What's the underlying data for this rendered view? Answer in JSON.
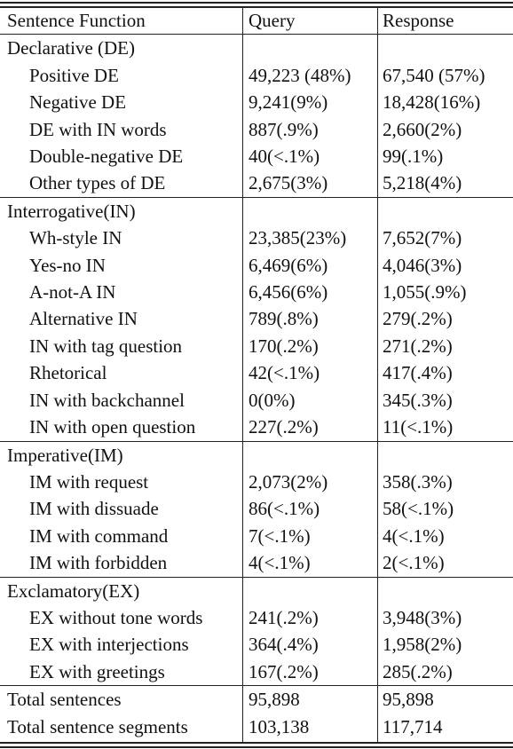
{
  "table": {
    "headers": [
      "Sentence Function",
      "Query",
      "Response"
    ],
    "groups": [
      {
        "label": "Declarative (DE)",
        "rows": [
          {
            "name": "Positive DE",
            "query": "49,223 (48%)",
            "response": "67,540 (57%)"
          },
          {
            "name": "Negative DE",
            "query": "9,241(9%)",
            "response": "18,428(16%)"
          },
          {
            "name": "DE with IN words",
            "query": "887(.9%)",
            "response": "2,660(2%)"
          },
          {
            "name": "Double-negative DE",
            "query": "40(<.1%)",
            "response": "99(.1%)"
          },
          {
            "name": "Other types of DE",
            "query": "2,675(3%)",
            "response": "5,218(4%)"
          }
        ]
      },
      {
        "label": "Interrogative(IN)",
        "rows": [
          {
            "name": "Wh-style IN",
            "query": "23,385(23%)",
            "response": "7,652(7%)"
          },
          {
            "name": "Yes-no IN",
            "query": "6,469(6%)",
            "response": "4,046(3%)"
          },
          {
            "name": "A-not-A IN",
            "query": "6,456(6%)",
            "response": "1,055(.9%)"
          },
          {
            "name": "Alternative IN",
            "query": "789(.8%)",
            "response": "279(.2%)"
          },
          {
            "name": "IN with tag question",
            "query": "170(.2%)",
            "response": "271(.2%)"
          },
          {
            "name": "Rhetorical",
            "query": "42(<.1%)",
            "response": "417(.4%)"
          },
          {
            "name": "IN with backchannel",
            "query": "0(0%)",
            "response": "345(.3%)"
          },
          {
            "name": "IN with open question",
            "query": "227(.2%)",
            "response": "11(<.1%)"
          }
        ]
      },
      {
        "label": "Imperative(IM)",
        "rows": [
          {
            "name": "IM with request",
            "query": "2,073(2%)",
            "response": "358(.3%)"
          },
          {
            "name": "IM with dissuade",
            "query": "86(<.1%)",
            "response": "58(<.1%)"
          },
          {
            "name": "IM with command",
            "query": "7(<.1%)",
            "response": "4(<.1%)"
          },
          {
            "name": "IM with forbidden",
            "query": "4(<.1%)",
            "response": "2(<.1%)"
          }
        ]
      },
      {
        "label": "Exclamatory(EX)",
        "rows": [
          {
            "name": "EX without tone words",
            "query": "241(.2%)",
            "response": "3,948(3%)"
          },
          {
            "name": "EX with interjections",
            "query": "364(.4%)",
            "response": "1,958(2%)"
          },
          {
            "name": "EX with greetings",
            "query": "167(.2%)",
            "response": "285(.2%)"
          }
        ]
      }
    ],
    "totals": [
      {
        "name": "Total sentences",
        "query": "95,898",
        "response": "95,898"
      },
      {
        "name": "Total sentence segments",
        "query": "103,138",
        "response": "117,714"
      }
    ]
  }
}
